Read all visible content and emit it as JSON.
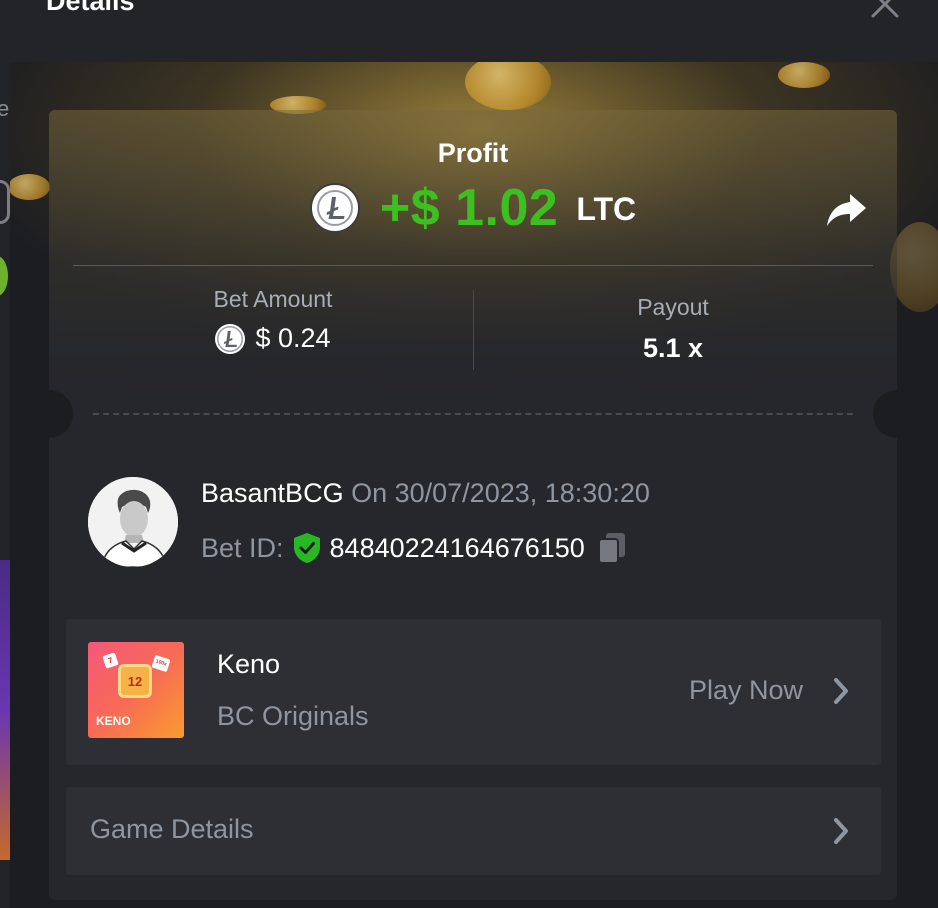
{
  "modal": {
    "title": "Details"
  },
  "background": {
    "edge_text": "e"
  },
  "profit": {
    "label": "Profit",
    "value": "+$ 1.02",
    "currency": "LTC"
  },
  "bet": {
    "amount_label": "Bet Amount",
    "amount_value": "$ 0.24",
    "payout_label": "Payout",
    "payout_value": "5.1 x"
  },
  "user": {
    "name": "BasantBCG",
    "time": "On 30/07/2023, 18:30:20",
    "bet_id_label": "Bet ID:",
    "bet_id": "84840224164676150"
  },
  "game": {
    "name": "Keno",
    "provider": "BC Originals",
    "play_label": "Play Now",
    "thumb_number": "12",
    "thumb_text": "KENO"
  },
  "details": {
    "label": "Game Details"
  },
  "icons": {
    "close": "close-icon",
    "share": "share-icon",
    "coin": "litecoin-icon",
    "verified": "shield-check-icon",
    "copy": "copy-icon",
    "chevron": "chevron-right-icon"
  },
  "colors": {
    "profit_green": "#3dc01f",
    "panel": "#26272c",
    "row": "#2e2f34",
    "muted_text": "#8e96a2",
    "verified_green": "#27b824"
  }
}
